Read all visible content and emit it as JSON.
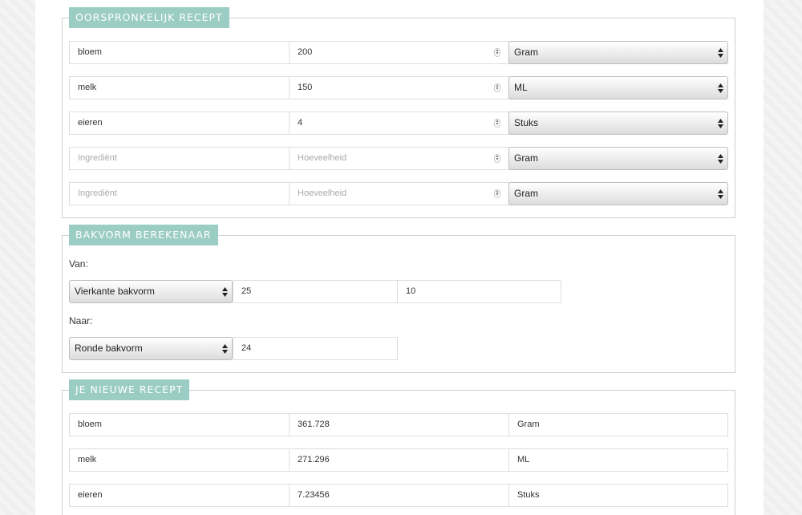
{
  "original": {
    "legend": "OORSPRONKELIJK RECEPT",
    "rows": [
      {
        "ingredient": "bloem",
        "amount": "200",
        "unit": "Gram",
        "is_placeholder": false
      },
      {
        "ingredient": "melk",
        "amount": "150",
        "unit": "ML",
        "is_placeholder": false
      },
      {
        "ingredient": "eieren",
        "amount": "4",
        "unit": "Stuks",
        "is_placeholder": false
      },
      {
        "ingredient": "Ingrediënt",
        "amount": "Hoeveelheid",
        "unit": "Gram",
        "is_placeholder": true
      },
      {
        "ingredient": "Ingrediënt",
        "amount": "Hoeveelheid",
        "unit": "Gram",
        "is_placeholder": true
      }
    ]
  },
  "calculator": {
    "legend": "BAKVORM BEREKENAAR",
    "from_label": "Van:",
    "from_shape": "Vierkante bakvorm",
    "from_dim1": "25",
    "from_dim2": "10",
    "to_label": "Naar:",
    "to_shape": "Ronde bakvorm",
    "to_dim1": "24"
  },
  "result": {
    "legend": "JE NIEUWE RECEPT",
    "rows": [
      {
        "ingredient": "bloem",
        "amount": "361.728",
        "unit": "Gram"
      },
      {
        "ingredient": "melk",
        "amount": "271.296",
        "unit": "ML"
      },
      {
        "ingredient": "eieren",
        "amount": "7.23456",
        "unit": "Stuks"
      }
    ]
  },
  "colors": {
    "legend_bg": "#9bcdc4",
    "border": "#cfcfcf"
  }
}
